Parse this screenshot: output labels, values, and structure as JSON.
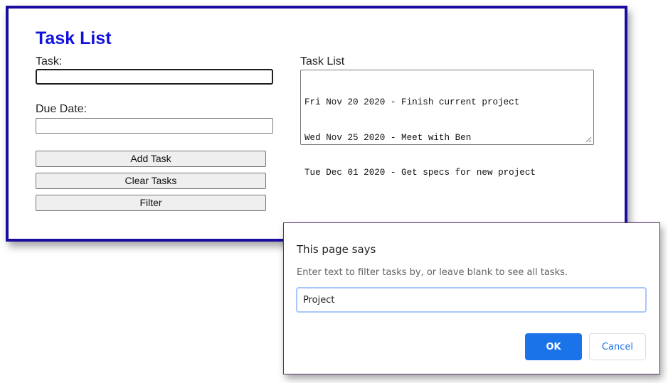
{
  "app": {
    "title": "Task List",
    "task_label": "Task:",
    "task_value": "",
    "due_date_label": "Due Date:",
    "due_date_value": "",
    "task_list_label": "Task List",
    "tasks": [
      "Fri Nov 20 2020 - Finish current project",
      "Wed Nov 25 2020 - Meet with Ben",
      "Tue Dec 01 2020 - Get specs for new project"
    ],
    "buttons": {
      "add_task": "Add Task",
      "clear_tasks": "Clear Tasks",
      "filter": "Filter"
    },
    "colors": {
      "title": "#1111dd",
      "panel_border": "#1a0d9e"
    }
  },
  "dialog": {
    "title": "This page says",
    "message": "Enter text to filter tasks by, or leave blank to see all tasks.",
    "input_value": "Project",
    "ok_label": "OK",
    "cancel_label": "Cancel",
    "colors": {
      "ok_background": "#1a73e8",
      "input_focus_border": "#a8c7fa"
    }
  }
}
